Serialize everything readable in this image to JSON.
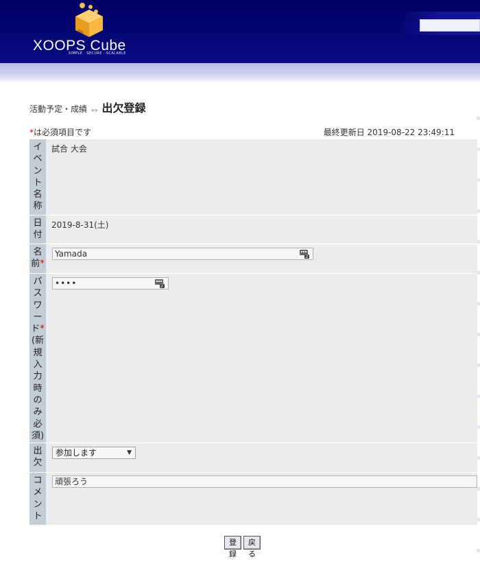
{
  "header": {
    "logo_text": "XOOPS Cube",
    "logo_tagline": "SIMPLE · SECURE · SCALABLE"
  },
  "breadcrumb": {
    "parent": "活動予定・成績",
    "separator": "»»",
    "current": "出欠登録"
  },
  "required_note": "は必須項目です",
  "required_star": "*",
  "last_updated": "最終更新日 2019-08-22 23:49:11",
  "form": {
    "event": {
      "label": "イベント名称",
      "value": "試合 大会"
    },
    "date": {
      "label": "日付",
      "value": "2019-8-31(土)"
    },
    "name": {
      "label": "名前",
      "value": "Yamada"
    },
    "password": {
      "label": "パスワード",
      "label_note": "(新規入力時のみ必須)",
      "value": "••••"
    },
    "attendance": {
      "label": "出欠",
      "selected": "参加します"
    },
    "comment": {
      "label": "コメント",
      "value": "頑張ろう"
    }
  },
  "buttons": {
    "save": "登録",
    "back": "戻る"
  },
  "colors": {
    "header_bg": "#000070",
    "label_bg": "#c4ccd4",
    "row_bg": "#ececec",
    "required": "#e00000"
  }
}
